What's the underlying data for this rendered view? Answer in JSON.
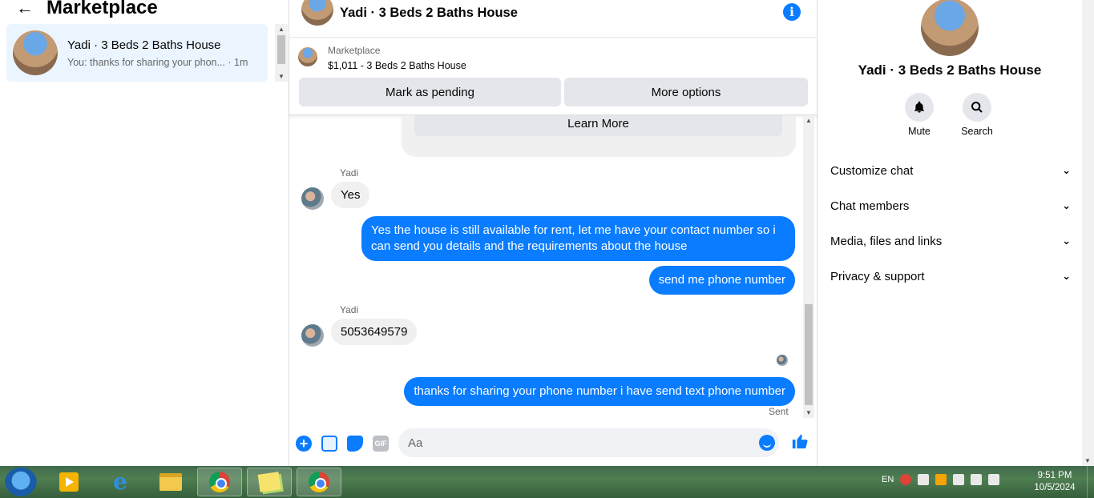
{
  "left": {
    "title": "Marketplace",
    "conversation": {
      "name": "Yadi · 3 Beds 2 Baths House",
      "snippet": "You: thanks for sharing your phon...",
      "time": "· 1m"
    }
  },
  "chat": {
    "header_title": "Yadi · 3 Beds 2 Baths House",
    "marketplace_label": "Marketplace",
    "listing": "$1,011 - 3 Beds 2 Baths House",
    "mark_pending": "Mark as pending",
    "more_options": "More options",
    "learn_more": "Learn More",
    "messages": {
      "sender1": "Yadi",
      "in1": "Yes",
      "out1": "Yes the house is still available for rent, let me have your contact number so i can send you details and the requirements about the house",
      "out2": "send me phone number",
      "sender2": "Yadi",
      "in2": "5053649579",
      "out3": "thanks for sharing your phone number i have send text phone number",
      "status": "Sent"
    },
    "composer": {
      "placeholder": "Aa",
      "gif_label": "GIF"
    }
  },
  "details": {
    "title": "Yadi · 3 Beds 2 Baths House",
    "mute_label": "Mute",
    "search_label": "Search",
    "sections": [
      "Customize chat",
      "Chat members",
      "Media, files and links",
      "Privacy & support"
    ]
  },
  "taskbar": {
    "language": "EN",
    "time": "9:51 PM",
    "date": "10/5/2024"
  },
  "colors": {
    "accent": "#0a7cff",
    "selected_conversation": "#ebf5ff",
    "bubble_incoming": "#f0f0f0"
  }
}
